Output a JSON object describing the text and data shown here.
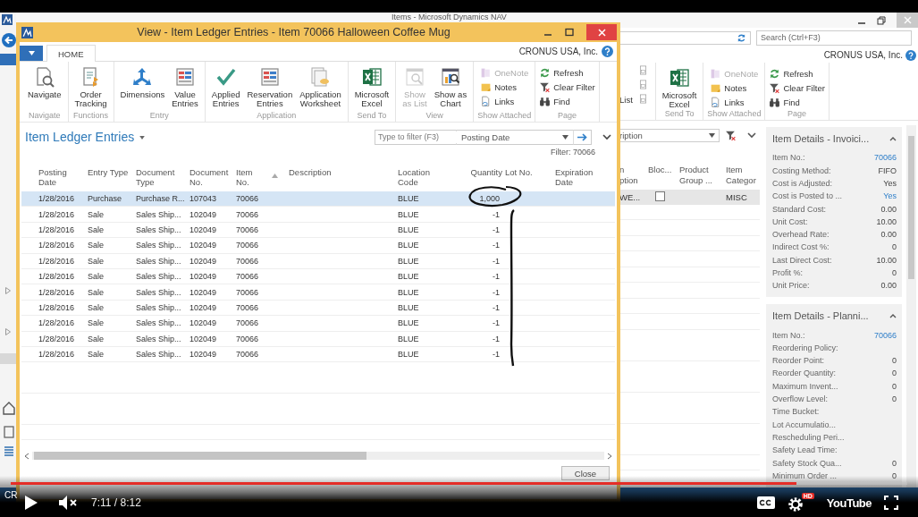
{
  "background_window": {
    "title": "Items - Microsoft Dynamics NAV",
    "search": {
      "placeholder": "Search (Ctrl+F3)"
    },
    "company": "CRONUS USA, Inc.",
    "ribbon": {
      "cut_group_fragment": "List",
      "groups": [
        {
          "label": "Send To",
          "kind": "large",
          "buttons": [
            {
              "label": "Microsoft\nExcel",
              "disabled": false
            }
          ]
        },
        {
          "label": "Show Attached",
          "kind": "small",
          "buttons": [
            {
              "label": "OneNote",
              "disabled": true
            },
            {
              "label": "Notes",
              "disabled": false
            },
            {
              "label": "Links",
              "disabled": false
            }
          ]
        },
        {
          "label": "Page",
          "kind": "small",
          "buttons": [
            {
              "label": "Refresh",
              "disabled": false
            },
            {
              "label": "Clear Filter",
              "disabled": false
            },
            {
              "label": "Find",
              "disabled": false
            }
          ]
        }
      ]
    },
    "list": {
      "filter_field": {
        "value": "ription"
      },
      "columns": [
        {
          "label": "n\nption"
        },
        {
          "label": "Bloc..."
        },
        {
          "label": "Product\nGroup ..."
        },
        {
          "label": "Item\nCategor"
        }
      ],
      "rows": [
        {
          "selected": true,
          "description": "WE...",
          "blocked": false,
          "item_category": "MISC"
        }
      ]
    },
    "factboxes": [
      {
        "title": "Item Details - Invoici...",
        "expanded": true,
        "fields": [
          {
            "label": "Item No.:",
            "value": "70066",
            "link": true
          },
          {
            "label": "Costing Method:",
            "value": "FIFO",
            "link": false
          },
          {
            "label": "Cost is Adjusted:",
            "value": "Yes",
            "link": false
          },
          {
            "label": "Cost is Posted to ...",
            "value": "Yes",
            "link": true
          },
          {
            "label": "Standard Cost:",
            "value": "0.00",
            "link": false
          },
          {
            "label": "Unit Cost:",
            "value": "10.00",
            "link": false
          },
          {
            "label": "Overhead Rate:",
            "value": "0.00",
            "link": false
          },
          {
            "label": "Indirect Cost %:",
            "value": "0",
            "link": false
          },
          {
            "label": "Last Direct Cost:",
            "value": "10.00",
            "link": false
          },
          {
            "label": "Profit %:",
            "value": "0",
            "link": false
          },
          {
            "label": "Unit Price:",
            "value": "0.00",
            "link": false
          }
        ]
      },
      {
        "title": "Item Details - Planni...",
        "expanded": true,
        "fields": [
          {
            "label": "Item No.:",
            "value": "70066",
            "link": true
          },
          {
            "label": "Reordering Policy:"
          },
          {
            "label": "Reorder Point:",
            "value": "0",
            "link": false
          },
          {
            "label": "Reorder Quantity:",
            "value": "0",
            "link": false
          },
          {
            "label": "Maximum Invent...",
            "value": "0",
            "link": false
          },
          {
            "label": "Overflow Level:",
            "value": "0",
            "link": false
          },
          {
            "label": "Time Bucket:"
          },
          {
            "label": "Lot Accumulatio..."
          },
          {
            "label": "Rescheduling Peri..."
          },
          {
            "label": "Safety Lead Time:"
          },
          {
            "label": "Safety Stock Qua...",
            "value": "0",
            "link": false
          },
          {
            "label": "Minimum Order ...",
            "value": "0",
            "link": false
          }
        ]
      }
    ],
    "status_bar": {
      "text": "CR"
    }
  },
  "dialog": {
    "title": "View - Item Ledger Entries - Item 70066 Halloween Coffee Mug",
    "company": "CRONUS USA, Inc.",
    "tabs": [
      {
        "label": "HOME",
        "selected": true
      }
    ],
    "ribbon": {
      "groups": [
        {
          "label": "Navigate",
          "kind": "large",
          "buttons": [
            {
              "label": "Navigate",
              "disabled": false
            }
          ]
        },
        {
          "label": "Functions",
          "kind": "large",
          "buttons": [
            {
              "label": "Order\nTracking",
              "disabled": false
            }
          ]
        },
        {
          "label": "Entry",
          "kind": "large",
          "buttons": [
            {
              "label": "Dimensions",
              "disabled": false
            },
            {
              "label": "Value\nEntries",
              "disabled": false
            }
          ]
        },
        {
          "label": "Application",
          "kind": "large",
          "buttons": [
            {
              "label": "Applied\nEntries",
              "disabled": false
            },
            {
              "label": "Reservation\nEntries",
              "disabled": false
            },
            {
              "label": "Application\nWorksheet",
              "disabled": false
            }
          ]
        },
        {
          "label": "Send To",
          "kind": "large",
          "buttons": [
            {
              "label": "Microsoft\nExcel",
              "disabled": false
            }
          ]
        },
        {
          "label": "View",
          "kind": "large",
          "buttons": [
            {
              "label": "Show\nas List",
              "disabled": true
            },
            {
              "label": "Show as\nChart",
              "disabled": false
            }
          ]
        },
        {
          "label": "Show Attached",
          "kind": "small",
          "buttons": [
            {
              "label": "OneNote",
              "disabled": true
            },
            {
              "label": "Notes",
              "disabled": false
            },
            {
              "label": "Links",
              "disabled": false
            }
          ]
        },
        {
          "label": "Page",
          "kind": "small",
          "buttons": [
            {
              "label": "Refresh",
              "disabled": false
            },
            {
              "label": "Clear Filter",
              "disabled": false
            },
            {
              "label": "Find",
              "disabled": false
            }
          ]
        }
      ]
    },
    "page_title": "Item Ledger Entries",
    "filter": {
      "placeholder": "Type to filter (F3)",
      "field": "Posting Date"
    },
    "filter_summary": "Filter: 70066",
    "columns": [
      {
        "label": "Posting\nDate",
        "sorted": false
      },
      {
        "label": "Entry Type",
        "sorted": false
      },
      {
        "label": "Document\nType",
        "sorted": false
      },
      {
        "label": "Document\nNo.",
        "sorted": false
      },
      {
        "label": "Item\nNo.",
        "sorted": true
      },
      {
        "label": "Description",
        "sorted": false
      },
      {
        "label": "Location\nCode",
        "sorted": false
      },
      {
        "label": "Quantity",
        "sorted": false
      },
      {
        "label": "Lot No.",
        "sorted": false
      },
      {
        "label": "Expiration\nDate",
        "sorted": false
      }
    ],
    "rows": [
      {
        "selected": true,
        "posting_date": "1/28/2016",
        "entry_type": "Purchase",
        "document_type": "Purchase R...",
        "document_no": "107043",
        "item_no": "70066",
        "location_code": "BLUE",
        "quantity": "1,000"
      },
      {
        "selected": false,
        "posting_date": "1/28/2016",
        "entry_type": "Sale",
        "document_type": "Sales Ship...",
        "document_no": "102049",
        "item_no": "70066",
        "location_code": "BLUE",
        "quantity": "-1"
      },
      {
        "selected": false,
        "posting_date": "1/28/2016",
        "entry_type": "Sale",
        "document_type": "Sales Ship...",
        "document_no": "102049",
        "item_no": "70066",
        "location_code": "BLUE",
        "quantity": "-1"
      },
      {
        "selected": false,
        "posting_date": "1/28/2016",
        "entry_type": "Sale",
        "document_type": "Sales Ship...",
        "document_no": "102049",
        "item_no": "70066",
        "location_code": "BLUE",
        "quantity": "-1"
      },
      {
        "selected": false,
        "posting_date": "1/28/2016",
        "entry_type": "Sale",
        "document_type": "Sales Ship...",
        "document_no": "102049",
        "item_no": "70066",
        "location_code": "BLUE",
        "quantity": "-1"
      },
      {
        "selected": false,
        "posting_date": "1/28/2016",
        "entry_type": "Sale",
        "document_type": "Sales Ship...",
        "document_no": "102049",
        "item_no": "70066",
        "location_code": "BLUE",
        "quantity": "-1"
      },
      {
        "selected": false,
        "posting_date": "1/28/2016",
        "entry_type": "Sale",
        "document_type": "Sales Ship...",
        "document_no": "102049",
        "item_no": "70066",
        "location_code": "BLUE",
        "quantity": "-1"
      },
      {
        "selected": false,
        "posting_date": "1/28/2016",
        "entry_type": "Sale",
        "document_type": "Sales Ship...",
        "document_no": "102049",
        "item_no": "70066",
        "location_code": "BLUE",
        "quantity": "-1"
      },
      {
        "selected": false,
        "posting_date": "1/28/2016",
        "entry_type": "Sale",
        "document_type": "Sales Ship...",
        "document_no": "102049",
        "item_no": "70066",
        "location_code": "BLUE",
        "quantity": "-1"
      },
      {
        "selected": false,
        "posting_date": "1/28/2016",
        "entry_type": "Sale",
        "document_type": "Sales Ship...",
        "document_no": "102049",
        "item_no": "70066",
        "location_code": "BLUE",
        "quantity": "-1"
      },
      {
        "selected": false,
        "posting_date": "1/28/2016",
        "entry_type": "Sale",
        "document_type": "Sales Ship...",
        "document_no": "102049",
        "item_no": "70066",
        "location_code": "BLUE",
        "quantity": "-1"
      }
    ],
    "close_button": "Close"
  },
  "pen_marks": [
    {
      "kind": "circle"
    },
    {
      "kind": "stroke"
    }
  ],
  "video_player": {
    "playing": false,
    "muted": true,
    "time": "7:11 / 8:12",
    "progress": {
      "level": 0.876
    },
    "hd_badge": "HD",
    "logo": "YouTube"
  }
}
